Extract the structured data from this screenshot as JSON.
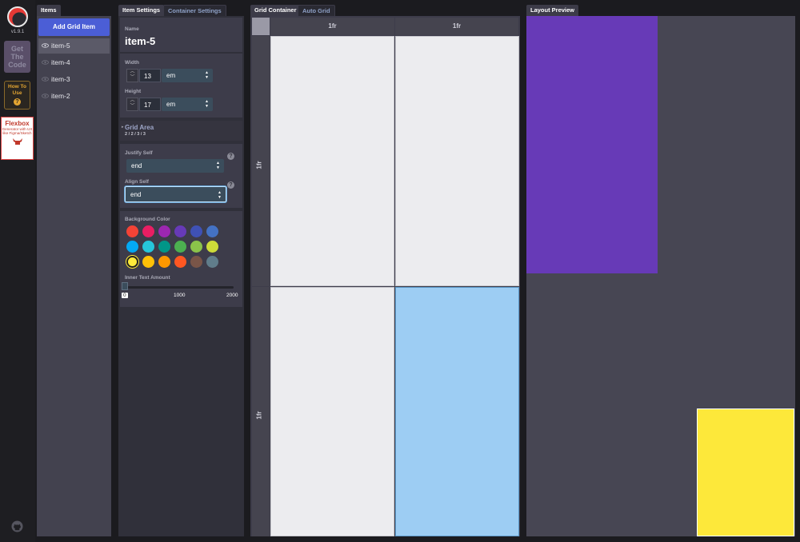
{
  "app": {
    "version": "v1.9.1",
    "get_code": "Get The Code",
    "how_to_use": "How To Use",
    "ad_title": "Flexbox",
    "ad_subtitle": "Generator with UX like Figma/Sketch"
  },
  "items_panel": {
    "tab": "Items",
    "add_label": "Add Grid Item",
    "items": [
      {
        "label": "item-5",
        "selected": true
      },
      {
        "label": "item-4",
        "selected": false
      },
      {
        "label": "item-3",
        "selected": false
      },
      {
        "label": "item-2",
        "selected": false
      }
    ]
  },
  "settings": {
    "tabs": [
      "Item Settings",
      "Container Settings"
    ],
    "name_label": "Name",
    "name_value": "item-5",
    "width_label": "Width",
    "width_value": "13",
    "width_unit": "em",
    "height_label": "Height",
    "height_value": "17",
    "height_unit": "em",
    "grid_area_label": "Grid Area",
    "grid_area_value": "2 / 2 / 3 / 3",
    "justify_label": "Justify Self",
    "justify_value": "end",
    "align_label": "Align Self",
    "align_value": "end",
    "bg_label": "Background Color",
    "inner_text_label": "Inner Text Amount",
    "range_min": "0",
    "range_mid": "1000",
    "range_max": "2000",
    "colors": [
      "#f44336",
      "#e91e63",
      "#9c27b0",
      "#673ab7",
      "#3f51b5",
      "#4472c4",
      "#03a9f4",
      "#26c6da",
      "#009688",
      "#4caf50",
      "#8bc34a",
      "#cddc39",
      "#ffeb3b",
      "#ffc107",
      "#ff9800",
      "#ff5722",
      "#795548",
      "#607d8b"
    ]
  },
  "grid": {
    "tabs": [
      "Grid Container",
      "Auto Grid"
    ],
    "columns": [
      "1fr",
      "1fr"
    ],
    "rows": [
      "1fr",
      "1fr"
    ]
  },
  "preview": {
    "tab": "Layout Preview",
    "purple": "#673ab7",
    "yellow": "#fde83a"
  }
}
